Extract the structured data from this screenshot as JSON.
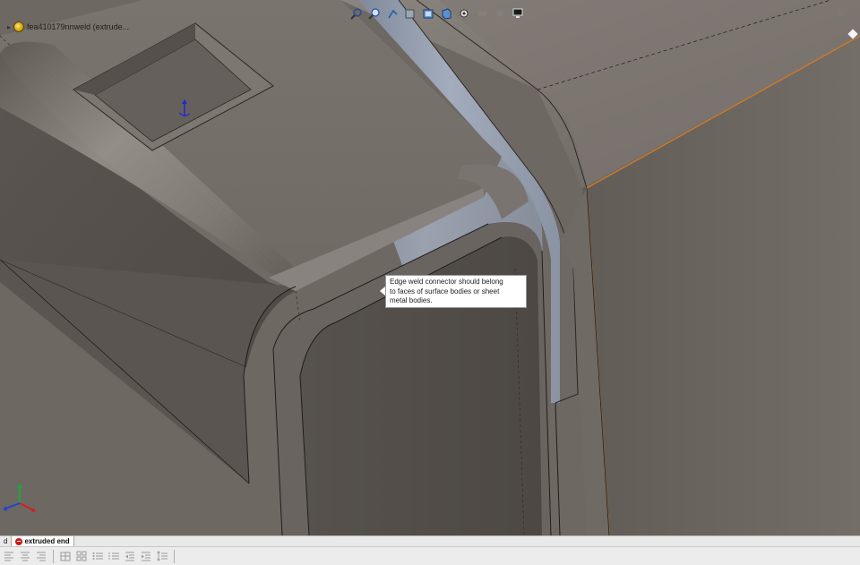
{
  "window": {
    "app": "SOLIDWORKS 3D modeling viewport",
    "background": "#6e6863"
  },
  "feature_tree": {
    "part_label": "fea410179nnweld  (extrude..."
  },
  "heads_up_toolbar": {
    "buttons": [
      {
        "name": "zoom-to-fit-icon"
      },
      {
        "name": "zoom-to-area-icon"
      },
      {
        "name": "previous-view-icon"
      },
      {
        "name": "section-view-icon"
      },
      {
        "name": "view-orientation-icon"
      },
      {
        "name": "display-style-icon"
      },
      {
        "name": "hide-show-items-icon"
      },
      {
        "name": "edit-appearance-icon"
      },
      {
        "name": "apply-scene-icon"
      },
      {
        "name": "view-settings-icon"
      }
    ]
  },
  "callout": {
    "text_line1": "Edge weld connector should belong",
    "text_line2": "to faces of surface bodies or sheet",
    "text_line3": "metal bodies."
  },
  "bottom_tabs": [
    {
      "label": "d",
      "active": false,
      "error": false
    },
    {
      "label": "extruded end",
      "active": true,
      "error": true
    }
  ],
  "format_toolbar": {
    "buttons": [
      "align-left-icon",
      "align-center-icon",
      "align-right-icon",
      "table-icon",
      "grid-icon",
      "bullets-icon",
      "numbering-icon",
      "indent-decrease-icon",
      "indent-increase-icon",
      "line-spacing-icon"
    ]
  },
  "colors": {
    "highlight_edge": "#e07a1a",
    "callout_bg": "#ffffff",
    "error": "#d01818"
  }
}
